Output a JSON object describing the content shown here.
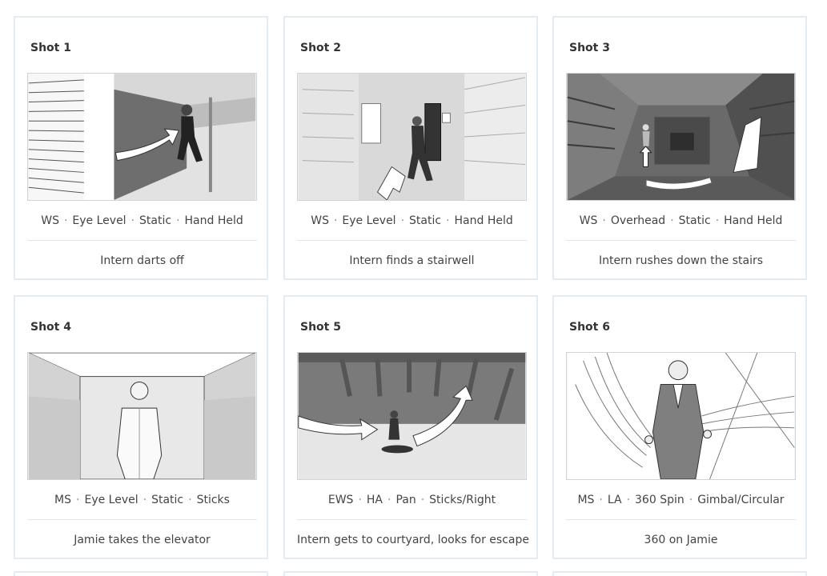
{
  "shots": [
    {
      "title": "Shot 1",
      "specs": [
        "WS",
        "Eye Level",
        "Static",
        "Hand Held"
      ],
      "description": "Intern darts off",
      "image_subject": "intern running down hallway"
    },
    {
      "title": "Shot 2",
      "specs": [
        "WS",
        "Eye Level",
        "Static",
        "Hand Held"
      ],
      "description": "Intern finds a stairwell",
      "image_subject": "intern entering stairwell door"
    },
    {
      "title": "Shot 3",
      "specs": [
        "WS",
        "Overhead",
        "Static",
        "Hand Held"
      ],
      "description": "Intern rushes down the stairs",
      "image_subject": "overhead view of stairwell"
    },
    {
      "title": "Shot 4",
      "specs": [
        "MS",
        "Eye Level",
        "Static",
        "Sticks"
      ],
      "description": "Jamie takes the elevator",
      "image_subject": "man standing in elevator"
    },
    {
      "title": "Shot 5",
      "specs": [
        "EWS",
        "HA",
        "Pan",
        "Sticks/Right"
      ],
      "description": "Intern gets to courtyard, looks for escape",
      "image_subject": "intern in courtyard high angle"
    },
    {
      "title": "Shot 6",
      "specs": [
        "MS",
        "LA",
        "360 Spin",
        "Gimbal/Circular"
      ],
      "description": "360 on Jamie",
      "image_subject": "man in suit low angle with spin lines"
    }
  ],
  "colors": {
    "card_border": "#e3ecf3",
    "text": "#444444",
    "title": "#333333"
  }
}
